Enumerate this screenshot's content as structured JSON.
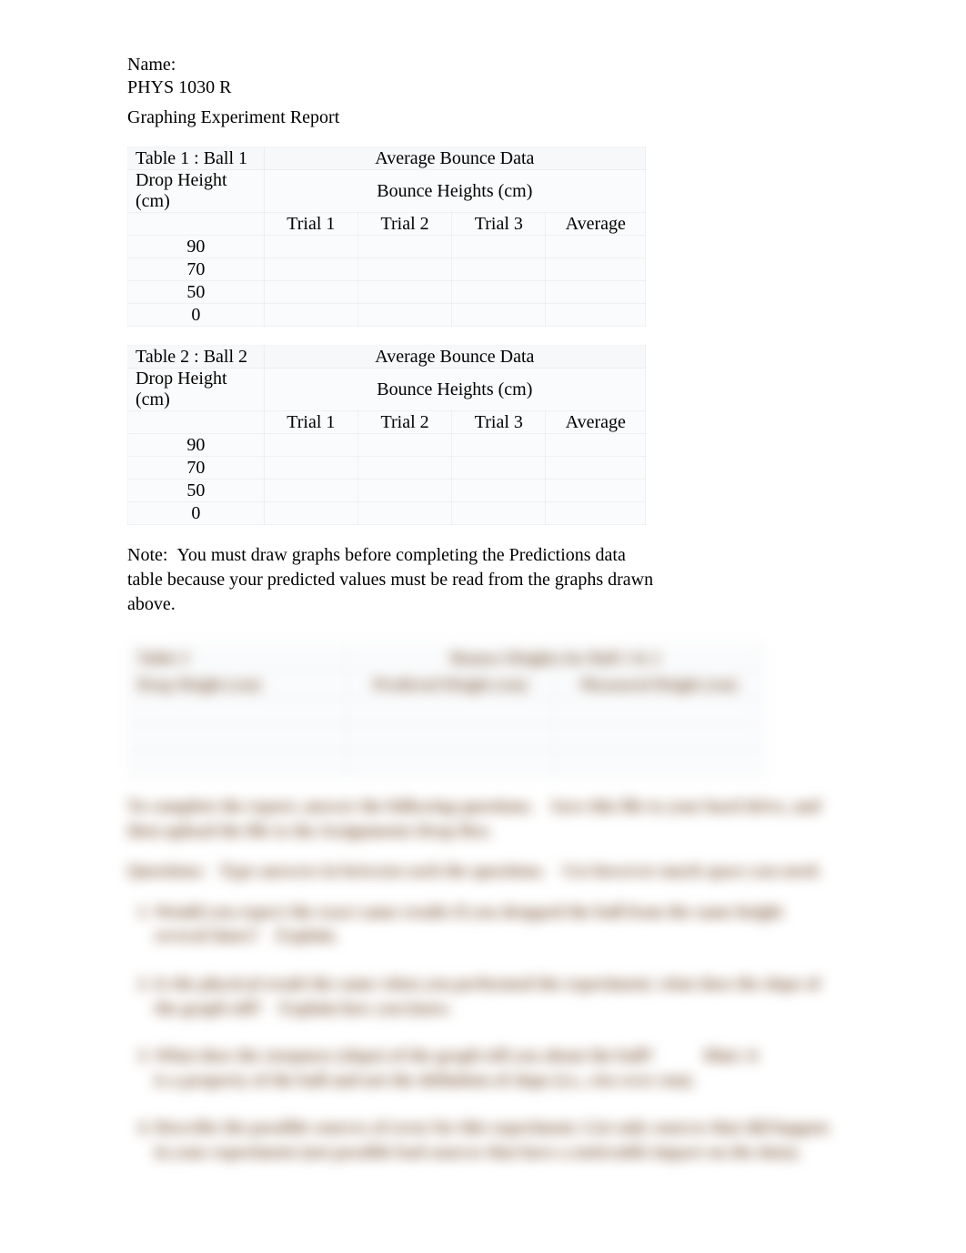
{
  "header": {
    "name_label": "Name:",
    "course": "PHYS 1030 R",
    "report_title": "Graphing Experiment Report"
  },
  "table1": {
    "title_prefix": "Table 1",
    "title_ball": ": Ball 1",
    "avg_label": "Average Bounce Data",
    "drop_label": "Drop Height (cm)",
    "bounce_label": "Bounce Heights (cm)",
    "trial1": "Trial 1",
    "trial2": "Trial 2",
    "trial3": "Trial 3",
    "average": "Average",
    "rows": [
      "90",
      "70",
      "50",
      "0"
    ]
  },
  "table2": {
    "title_prefix": "Table 2",
    "title_ball": ": Ball 2",
    "avg_label": "Average Bounce Data",
    "drop_label": "Drop Height (cm)",
    "bounce_label": "Bounce Heights (cm)",
    "trial1": "Trial 1",
    "trial2": "Trial 2",
    "trial3": "Trial 3",
    "average": "Average",
    "rows": [
      "90",
      "70",
      "50",
      "0"
    ]
  },
  "note": {
    "prefix": "Note:",
    "text": "You must draw graphs before completing the Predictions data table because your predicted values must be read from the graphs drawn above."
  },
  "blurred": {
    "table3": {
      "title": "Table 3",
      "col_mid_title": "Bounce Heights for Ball 1 & 2",
      "drop_label": "Drop Height (cm)",
      "predicted": "Predicted Height (cm)",
      "measured": "Measured Height (cm)"
    },
    "para1": "To complete the report, answer the following questions.    Save this file to your hard drive, and then upload the file to the Assignments Drop Box.",
    "para2": "Questions:   Type answers in between each the questions.    Use however much space you need.",
    "q1": "Would you expect the exact same results if you dropped the ball from the same height several times?    Explain.",
    "q2": "Is the physical result the same when you performed the experiment; what does the slope of the graph tell?    Explain how you know.",
    "q3_a": "What does the steepness (slope) of the graph tell you about the ball?",
    "q3_b": "Hint: it is a property of the ball and not the definition of slope (i.e., rise over run).",
    "q4": "Describe the possible sources of error for this experiment. List only sources that did happen in your experiment (not possible bad sources that have a noticeable impact on the data)."
  }
}
